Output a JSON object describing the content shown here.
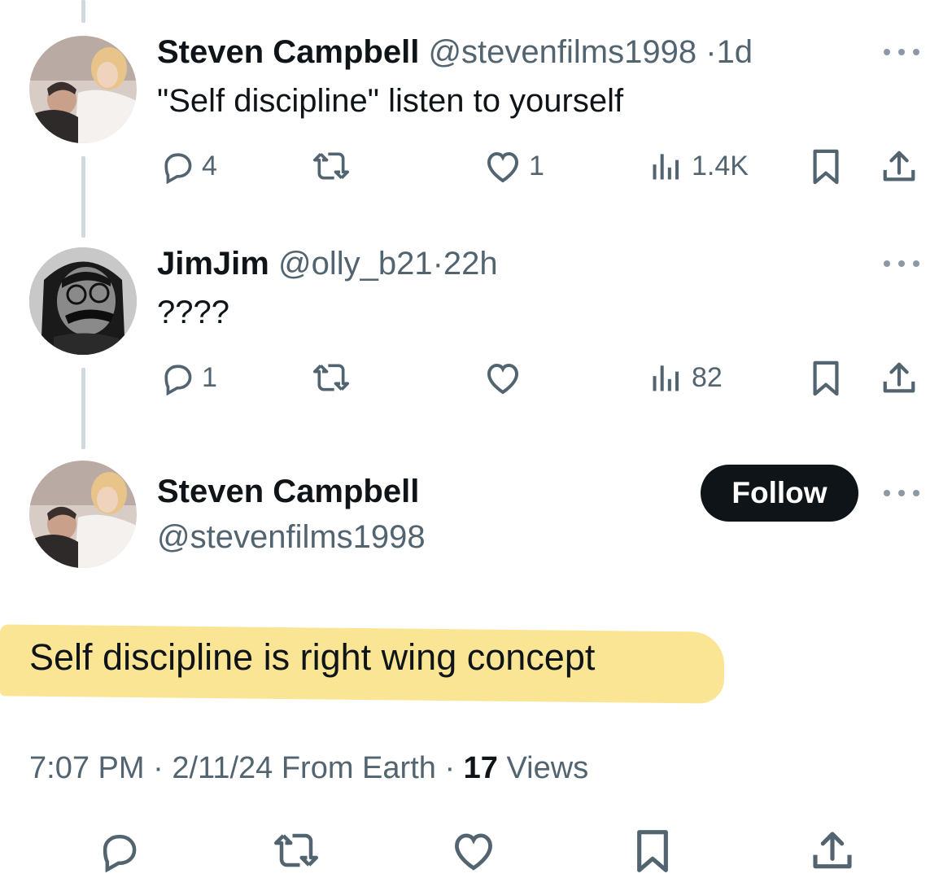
{
  "colors": {
    "text": "#0f1419",
    "muted": "#536471",
    "thread_line": "#cfd9de",
    "highlight": "#fae28a",
    "follow_bg": "#0f1419"
  },
  "tweets": [
    {
      "name": "Steven Campbell",
      "handle": "@stevenfilms1998",
      "sep": "·",
      "time": "1d",
      "text": "\"Self discipline\" listen to yourself",
      "replies": "4",
      "reposts": "",
      "likes": "1",
      "views": "1.4K",
      "icons": [
        "reply-icon",
        "repost-icon",
        "like-icon",
        "views-icon",
        "bookmark-icon",
        "share-icon"
      ]
    },
    {
      "name": "JimJim",
      "handle": "@olly_b21",
      "sep": "·",
      "time": "22h",
      "text": "????",
      "replies": "1",
      "reposts": "",
      "likes": "",
      "views": "82",
      "icons": [
        "reply-icon",
        "repost-icon",
        "like-icon",
        "views-icon",
        "bookmark-icon",
        "share-icon"
      ]
    }
  ],
  "main_tweet": {
    "name": "Steven Campbell",
    "handle": "@stevenfilms1998",
    "follow_label": "Follow",
    "text": "Self discipline is right wing concept",
    "time": "7:07 PM",
    "sep1": "·",
    "date": "2/11/24",
    "location": "From Earth",
    "sep2": "·",
    "views_count": "17",
    "views_label": "Views"
  }
}
